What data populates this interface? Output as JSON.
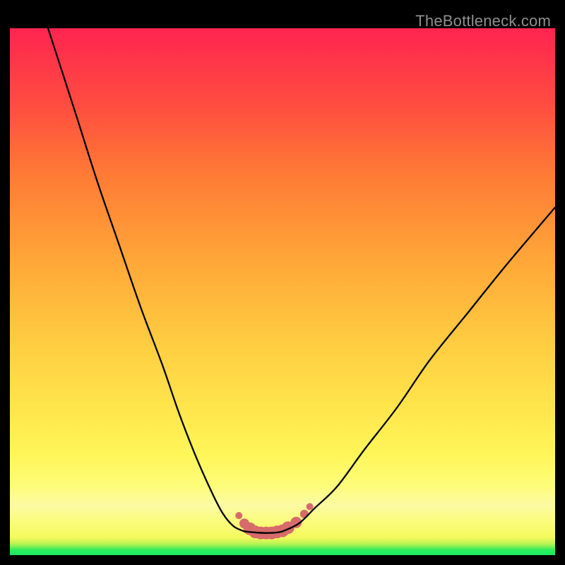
{
  "watermark": "TheBottleneck.com",
  "chart_data": {
    "type": "line",
    "title": "",
    "xlabel": "",
    "ylabel": "",
    "xlim": [
      0,
      100
    ],
    "ylim": [
      0,
      100
    ],
    "grid": false,
    "series": [
      {
        "name": "left-curve",
        "x": [
          7,
          12,
          16,
          20,
          24,
          28,
          31,
          34,
          37,
          39,
          41,
          43
        ],
        "y": [
          100,
          84,
          71,
          59,
          47,
          36,
          27,
          19,
          12,
          8,
          5.5,
          4.5
        ]
      },
      {
        "name": "right-curve",
        "x": [
          50,
          53,
          56,
          60,
          65,
          71,
          77,
          84,
          91,
          100
        ],
        "y": [
          4.5,
          6,
          9,
          13,
          20,
          28,
          37,
          46,
          55,
          66
        ]
      },
      {
        "name": "valley-flat",
        "x": [
          43,
          45,
          47,
          49,
          50
        ],
        "y": [
          4.5,
          4.3,
          4.2,
          4.3,
          4.5
        ]
      }
    ],
    "markers": {
      "name": "valley-dots",
      "color": "#d76a6a",
      "points": [
        {
          "x": 42,
          "y": 7.5,
          "r": 5
        },
        {
          "x": 43,
          "y": 6.0,
          "r": 7
        },
        {
          "x": 44,
          "y": 5.0,
          "r": 9
        },
        {
          "x": 45,
          "y": 4.4,
          "r": 9
        },
        {
          "x": 46,
          "y": 4.2,
          "r": 9
        },
        {
          "x": 47,
          "y": 4.2,
          "r": 9
        },
        {
          "x": 48,
          "y": 4.2,
          "r": 9
        },
        {
          "x": 49,
          "y": 4.4,
          "r": 9
        },
        {
          "x": 50,
          "y": 4.6,
          "r": 9
        },
        {
          "x": 51,
          "y": 5.2,
          "r": 9
        },
        {
          "x": 52.5,
          "y": 6.2,
          "r": 8
        },
        {
          "x": 54,
          "y": 7.8,
          "r": 6
        },
        {
          "x": 55,
          "y": 9.2,
          "r": 5
        }
      ]
    }
  }
}
